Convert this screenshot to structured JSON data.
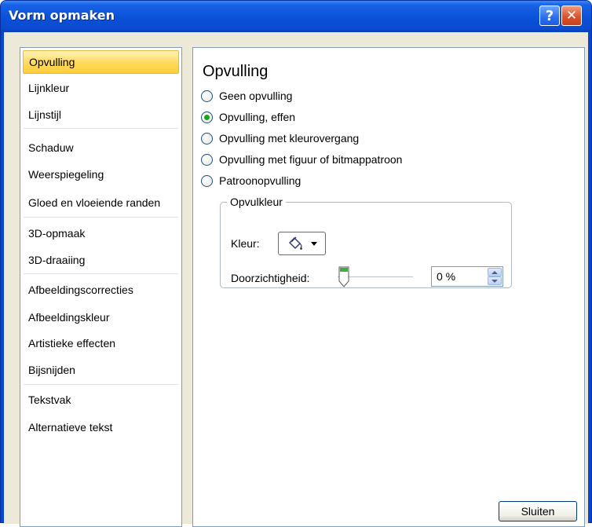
{
  "window": {
    "title": "Vorm opmaken"
  },
  "nav": {
    "items": [
      {
        "label": "Opvulling",
        "selected": true
      },
      {
        "label": "Lijnkleur"
      },
      {
        "label": "Lijnstijl"
      },
      {
        "label": "Schaduw"
      },
      {
        "label": "Weerspiegeling"
      },
      {
        "label": "Gloed en vloeiende randen"
      },
      {
        "label": "3D-opmaak"
      },
      {
        "label": "3D-draaiing"
      },
      {
        "label": "Afbeeldingscorrecties"
      },
      {
        "label": "Afbeeldingskleur"
      },
      {
        "label": "Artistieke effecten"
      },
      {
        "label": "Bijsnijden"
      },
      {
        "label": "Tekstvak"
      },
      {
        "label": "Alternatieve tekst"
      }
    ]
  },
  "panel": {
    "title": "Opvulling",
    "options": [
      {
        "label": "Geen opvulling",
        "selected": false
      },
      {
        "label": "Opvulling, effen",
        "selected": true
      },
      {
        "label": "Opvulling met kleurovergang",
        "selected": false
      },
      {
        "label": "Opvulling met figuur of bitmappatroon",
        "selected": false
      },
      {
        "label": "Patroonopvulling",
        "selected": false
      }
    ],
    "group": {
      "label": "Opvulkleur",
      "color_label": "Kleur:",
      "transparency_label": "Doorzichtigheid:",
      "transparency_value": "0 %",
      "transparency_level": 0
    }
  },
  "footer": {
    "close_label": "Sluiten"
  },
  "colors": {
    "titlebar": "#0b52d8",
    "selection": "#ffd95c",
    "radio_dot": "#21a121"
  },
  "icons": {
    "help": "question-mark",
    "close": "x",
    "color": "paint-bucket"
  }
}
